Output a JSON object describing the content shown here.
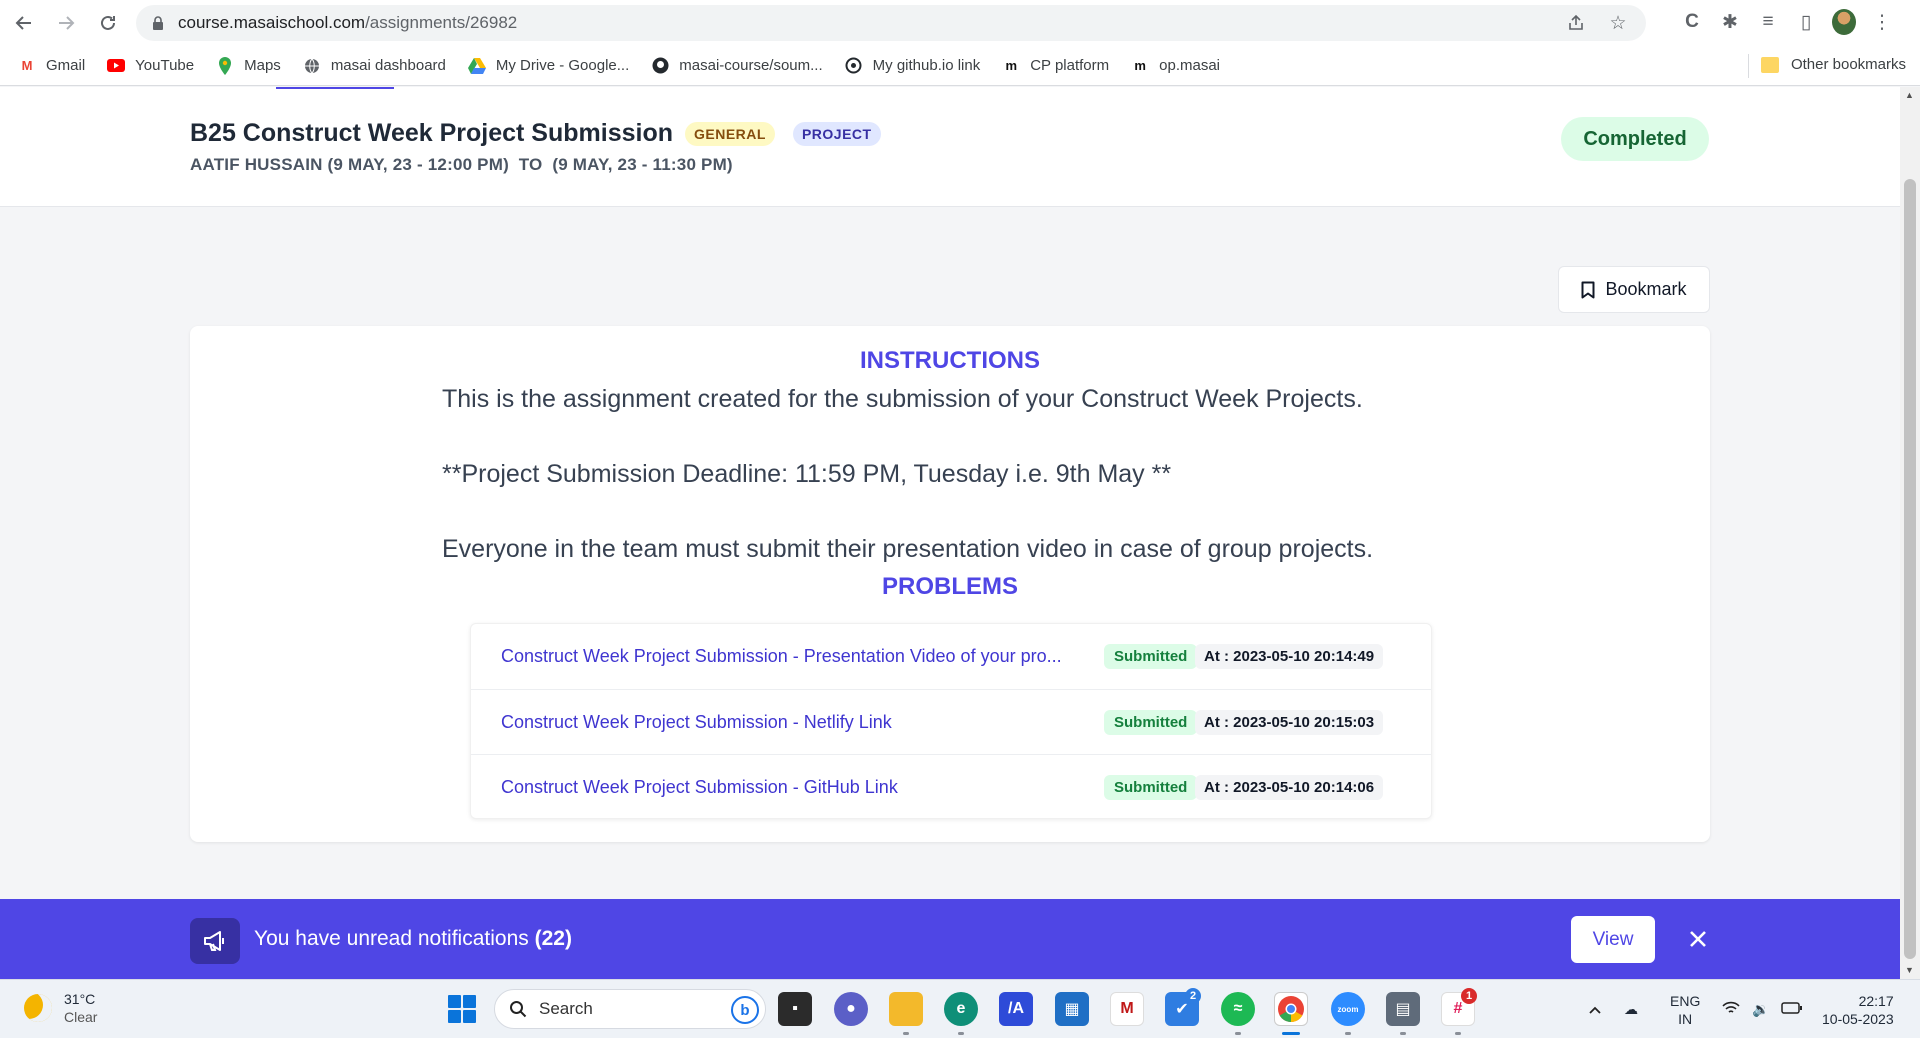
{
  "browser": {
    "url_host": "course.masaischool.com",
    "url_path": "/assignments/26982",
    "bookmarks": [
      {
        "label": "Gmail",
        "icon": "gmail-icon"
      },
      {
        "label": "YouTube",
        "icon": "youtube-icon"
      },
      {
        "label": "Maps",
        "icon": "maps-icon"
      },
      {
        "label": "masai dashboard",
        "icon": "globe-icon"
      },
      {
        "label": "My Drive - Google...",
        "icon": "drive-icon"
      },
      {
        "label": "masai-course/soum...",
        "icon": "github-icon"
      },
      {
        "label": "My github.io link",
        "icon": "github-io-icon"
      },
      {
        "label": "CP platform",
        "icon": "masai-m-icon"
      },
      {
        "label": "op.masai",
        "icon": "masai-m-icon"
      }
    ],
    "other_bookmarks": "Other bookmarks"
  },
  "header": {
    "title": "B25 Construct Week Project Submission",
    "tags": [
      "GENERAL",
      "PROJECT"
    ],
    "subtitle": "AATIF HUSSAIN (9 MAY, 23 - 12:00 PM)  TO  (9 MAY, 23 - 11:30 PM)",
    "status": "Completed"
  },
  "bookmark_button": "Bookmark",
  "instructions": {
    "heading": "INSTRUCTIONS",
    "lines": [
      "This is the assignment created for the submission of your Construct Week Projects.",
      "**Project Submission Deadline: 11:59 PM, Tuesday i.e. 9th May **",
      "Everyone in the team must submit their presentation video in case of group projects."
    ]
  },
  "problems": {
    "heading": "PROBLEMS",
    "items": [
      {
        "title": "Construct Week Project Submission - Presentation Video of your pro...",
        "status": "Submitted",
        "time": "At : 2023-05-10 20:14:49"
      },
      {
        "title": "Construct Week Project Submission - Netlify Link",
        "status": "Submitted",
        "time": "At : 2023-05-10 20:15:03"
      },
      {
        "title": "Construct Week Project Submission - GitHub Link",
        "status": "Submitted",
        "time": "At : 2023-05-10 20:14:06"
      }
    ]
  },
  "notification": {
    "text": "You have unread notifications",
    "count": "(22)",
    "view": "View"
  },
  "taskbar": {
    "temperature": "31°C",
    "weather": "Clear",
    "search": "Search",
    "lang": "ENG",
    "region": "IN",
    "time": "22:17",
    "date": "10-05-2023",
    "badge_todo": "2",
    "badge_slack": "1"
  },
  "colors": {
    "accent": "#4f46e5",
    "success_bg": "#dcfce7",
    "success_fg": "#166534"
  }
}
